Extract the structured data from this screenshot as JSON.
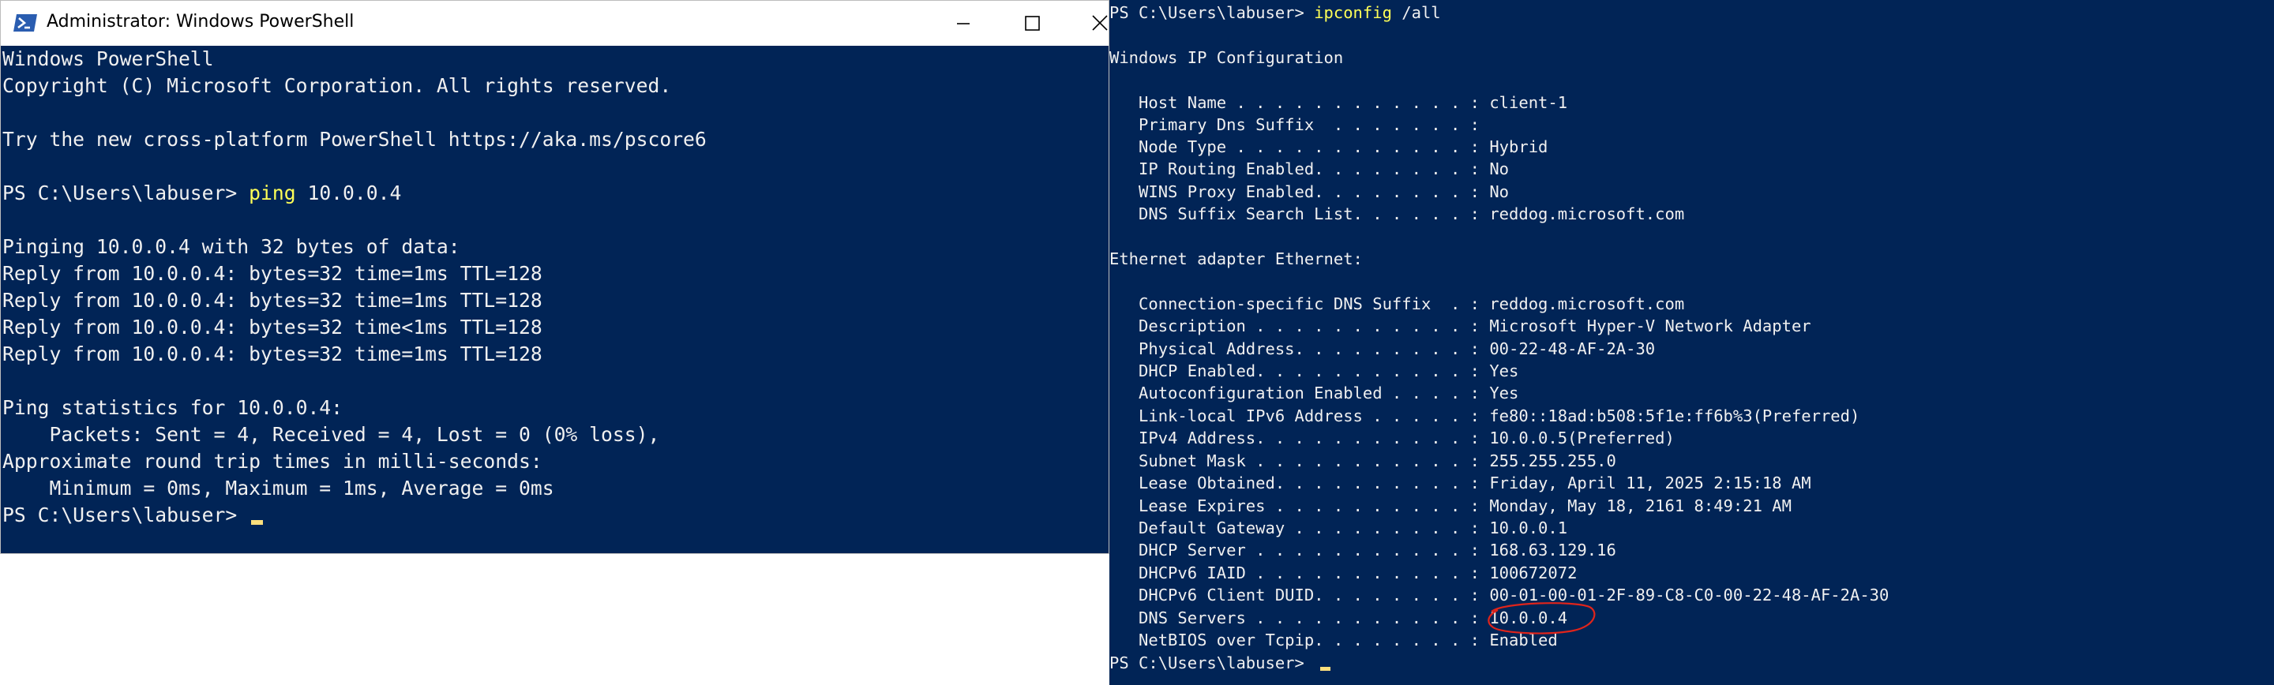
{
  "left_window": {
    "title": "Administrator: Windows PowerShell",
    "icons": {
      "app": "powershell-icon",
      "minimize": "minimize-icon",
      "maximize": "maximize-icon",
      "close": "close-icon"
    },
    "lines": [
      "Windows PowerShell",
      "Copyright (C) Microsoft Corporation. All rights reserved.",
      "",
      "Try the new cross-platform PowerShell https://aka.ms/pscore6",
      "",
      "",
      "",
      "Pinging 10.0.0.4 with 32 bytes of data:",
      "Reply from 10.0.0.4: bytes=32 time=1ms TTL=128",
      "Reply from 10.0.0.4: bytes=32 time=1ms TTL=128",
      "Reply from 10.0.0.4: bytes=32 time<1ms TTL=128",
      "Reply from 10.0.0.4: bytes=32 time=1ms TTL=128",
      "",
      "Ping statistics for 10.0.0.4:",
      "    Packets: Sent = 4, Received = 4, Lost = 0 (0% loss),",
      "Approximate round trip times in milli-seconds:",
      "    Minimum = 0ms, Maximum = 1ms, Average = 0ms"
    ],
    "command_prompt": "PS C:\\Users\\labuser> ",
    "command_name": "ping",
    "command_args": " 10.0.0.4",
    "final_prompt": "PS C:\\Users\\labuser> "
  },
  "right_window": {
    "command_prompt": "PS C:\\Users\\labuser> ",
    "command_name": "ipconfig",
    "command_args": " /all",
    "lines": [
      "",
      "Windows IP Configuration",
      "",
      "   Host Name . . . . . . . . . . . . : client-1",
      "   Primary Dns Suffix  . . . . . . . :",
      "   Node Type . . . . . . . . . . . . : Hybrid",
      "   IP Routing Enabled. . . . . . . . : No",
      "   WINS Proxy Enabled. . . . . . . . : No",
      "   DNS Suffix Search List. . . . . . : reddog.microsoft.com",
      "",
      "Ethernet adapter Ethernet:",
      "",
      "   Connection-specific DNS Suffix  . : reddog.microsoft.com",
      "   Description . . . . . . . . . . . : Microsoft Hyper-V Network Adapter",
      "   Physical Address. . . . . . . . . : 00-22-48-AF-2A-30",
      "   DHCP Enabled. . . . . . . . . . . : Yes",
      "   Autoconfiguration Enabled . . . . : Yes",
      "   Link-local IPv6 Address . . . . . : fe80::18ad:b508:5f1e:ff6b%3(Preferred)",
      "   IPv4 Address. . . . . . . . . . . : 10.0.0.5(Preferred)",
      "   Subnet Mask . . . . . . . . . . . : 255.255.255.0",
      "   Lease Obtained. . . . . . . . . . : Friday, April 11, 2025 2:15:18 AM",
      "   Lease Expires . . . . . . . . . . : Monday, May 18, 2161 8:49:21 AM",
      "   Default Gateway . . . . . . . . . : 10.0.0.1",
      "   DHCP Server . . . . . . . . . . . : 168.63.129.16",
      "   DHCPv6 IAID . . . . . . . . . . . : 100672072",
      "   DHCPv6 Client DUID. . . . . . . . : 00-01-00-01-2F-89-C8-C0-00-22-48-AF-2A-30",
      "   DNS Servers . . . . . . . . . . . : 10.0.0.4",
      "   NetBIOS over Tcpip. . . . . . . . : Enabled"
    ],
    "final_prompt": "PS C:\\Users\\labuser> "
  },
  "colors": {
    "console_background": "#012456",
    "console_text": "#f0f0f0",
    "command_highlight": "#ffff57",
    "cursor": "#fddf7d",
    "annotation_circle": "#e0241b"
  }
}
